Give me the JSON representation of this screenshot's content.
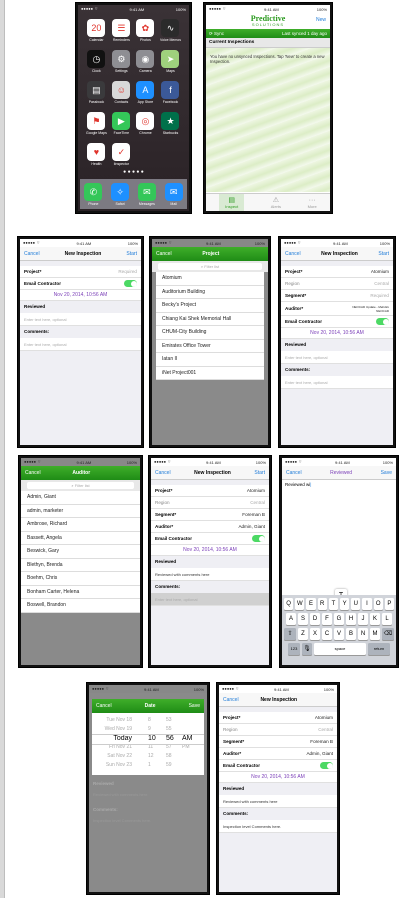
{
  "home": {
    "time": "9:41 AM",
    "battery": "100%",
    "apps": [
      {
        "label": "Calendar",
        "color": "#ffffff",
        "glyph": "20",
        "icon": "calendar-icon"
      },
      {
        "label": "Reminders",
        "color": "#ffffff",
        "glyph": "☰",
        "icon": "reminders-icon"
      },
      {
        "label": "Photos",
        "color": "#ffffff",
        "glyph": "✿",
        "icon": "photos-icon"
      },
      {
        "label": "Voice Memos",
        "color": "#2b2b2b",
        "glyph": "∿",
        "icon": "voice-memos-icon"
      },
      {
        "label": "Clock",
        "color": "#111111",
        "glyph": "◷",
        "icon": "clock-icon"
      },
      {
        "label": "Settings",
        "color": "#8e8e93",
        "glyph": "⚙",
        "icon": "settings-icon"
      },
      {
        "label": "Camera",
        "color": "#8e8e93",
        "glyph": "◉",
        "icon": "camera-icon"
      },
      {
        "label": "Maps",
        "color": "#9fd17d",
        "glyph": "➤",
        "icon": "maps-icon"
      },
      {
        "label": "Passbook",
        "color": "#3a3a3c",
        "glyph": "▤",
        "icon": "passbook-icon"
      },
      {
        "label": "Contacts",
        "color": "#d8d8d8",
        "glyph": "☺",
        "icon": "contacts-icon"
      },
      {
        "label": "App Store",
        "color": "#1e90ff",
        "glyph": "A",
        "icon": "app-store-icon"
      },
      {
        "label": "Facebook",
        "color": "#3b5998",
        "glyph": "f",
        "icon": "facebook-icon"
      },
      {
        "label": "Google Maps",
        "color": "#ffffff",
        "glyph": "⚑",
        "icon": "google-maps-icon"
      },
      {
        "label": "FaceTime",
        "color": "#34c759",
        "glyph": "▶",
        "icon": "facetime-icon"
      },
      {
        "label": "Chrome",
        "color": "#ffffff",
        "glyph": "◎",
        "icon": "chrome-icon"
      },
      {
        "label": "Starbucks",
        "color": "#00704a",
        "glyph": "★",
        "icon": "starbucks-icon"
      },
      {
        "label": "Health",
        "color": "#ffffff",
        "glyph": "♥",
        "icon": "health-icon"
      },
      {
        "label": "iInspector",
        "color": "#ffffff",
        "glyph": "✓",
        "icon": "iinspector-icon"
      }
    ],
    "dock": [
      {
        "label": "Phone",
        "color": "#34c759",
        "glyph": "✆",
        "icon": "phone-icon"
      },
      {
        "label": "Safari",
        "color": "#1e90ff",
        "glyph": "✧",
        "icon": "safari-icon"
      },
      {
        "label": "Messages",
        "color": "#34c759",
        "glyph": "✉",
        "icon": "messages-icon"
      },
      {
        "label": "Mail",
        "color": "#1e90ff",
        "glyph": "✉",
        "icon": "mail-icon"
      }
    ],
    "reminders_badge": "1",
    "mail_badge": "1,270"
  },
  "inspections": {
    "logo_main": "Predictive",
    "logo_sub": "SOLUTIONS",
    "new_label": "New",
    "sync_label": "Sync",
    "last_synced": "Last synced 1 day ago",
    "section": "Current Inspections",
    "empty_text": "You have no unsynced Inspections. Tap 'New' to create a new Inspection.",
    "tabs": [
      "Inspect",
      "Alerts",
      "More"
    ]
  },
  "new_inspection": {
    "title": "New Inspection",
    "cancel": "Cancel",
    "start": "Start",
    "project_label": "Project*",
    "project_required": "Required",
    "project_value": "Atomium",
    "region_label": "Region",
    "region_value": "Central",
    "segment_label": "Segment*",
    "segment_required": "Required",
    "segment_value": "Foreman B",
    "auditor_label": "Auditor*",
    "auditor_value_small": "NEOCAD Update - Mehdi/o NEOCAD",
    "auditor_value": "Admin, Giant",
    "email_label": "Email Contractor",
    "date": "Nov 20, 2014, 10:56 AM",
    "reviewed_label": "Reviewed",
    "reviewed_placeholder": "Enter text here, optional",
    "reviewed_value": "Reviewed with comments here",
    "comments_label": "Comments:",
    "comments_placeholder": "Enter text here, optional",
    "comments_value": "Inspection level Comments here."
  },
  "project_picker": {
    "cancel": "Cancel",
    "title": "Project",
    "filter": "Filter list",
    "items": [
      "Atomium",
      "Auditorium Building",
      "Becky's Project",
      "Chiang Kai Shek Memorial Hall",
      "CHUM-City Building",
      "Emirates Office Tower",
      "Iatan II",
      "iNet Project001"
    ]
  },
  "auditor_picker": {
    "cancel": "Cancel",
    "title": "Auditor",
    "filter": "Filter list",
    "items": [
      "Admin, Giant",
      "admin, marketer",
      "Ambrose, Richard",
      "Bassett, Angela",
      "Beswick, Gary",
      "Blethyn, Brenda",
      "Boehm, Chris",
      "Bonham Carter, Helena",
      "Boswell, Brandon"
    ]
  },
  "reviewed_editor": {
    "cancel": "Cancel",
    "title": "Reviewed",
    "save": "Save",
    "text": "Reviewed wi",
    "popup_key": "T",
    "row1": [
      "Q",
      "W",
      "E",
      "R",
      "T",
      "Y",
      "U",
      "I",
      "O",
      "P"
    ],
    "row2": [
      "A",
      "S",
      "D",
      "F",
      "G",
      "H",
      "J",
      "K",
      "L"
    ],
    "row3": [
      "Z",
      "X",
      "C",
      "V",
      "B",
      "N",
      "M"
    ],
    "num_key": "123",
    "space": "space",
    "return": "return"
  },
  "date_picker": {
    "cancel": "Cancel",
    "title": "Date",
    "save": "Save",
    "rows": [
      {
        "day": "Tue Nov 18",
        "h": "8",
        "m": "53",
        "ap": ""
      },
      {
        "day": "Wed Nov 19",
        "h": "9",
        "m": "55",
        "ap": ""
      },
      {
        "day": "Today",
        "h": "10",
        "m": "56",
        "ap": "AM"
      },
      {
        "day": "Fri Nov 21",
        "h": "11",
        "m": "57",
        "ap": "PM"
      },
      {
        "day": "Sat Nov 22",
        "h": "12",
        "m": "58",
        "ap": ""
      },
      {
        "day": "Sun Nov 23",
        "h": "1",
        "m": "59",
        "ap": ""
      }
    ]
  },
  "colors": {
    "green": "#2a9a1e",
    "blue": "#1e7bd8",
    "purple": "#7b3fb8",
    "toggle": "#4cd964"
  }
}
